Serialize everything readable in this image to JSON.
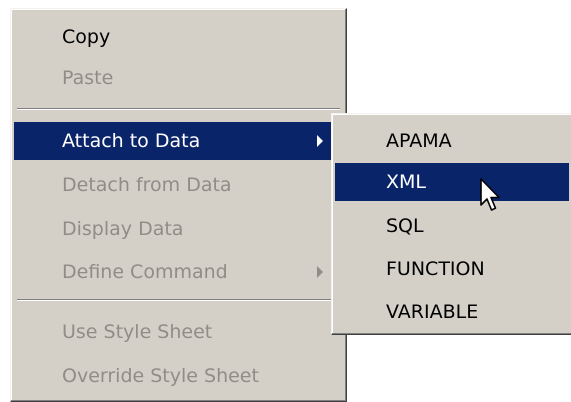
{
  "main_menu": {
    "copy": "Copy",
    "paste": "Paste",
    "attach_to_data": "Attach to Data",
    "detach_from_data": "Detach from Data",
    "display_data": "Display Data",
    "define_command": "Define Command",
    "use_style_sheet": "Use Style Sheet",
    "override_style_sheet": "Override Style Sheet"
  },
  "sub_menu": {
    "apama": "APAMA",
    "xml": "XML",
    "sql": "SQL",
    "function": "FUNCTION",
    "variable": "VARIABLE"
  },
  "state": {
    "highlighted_main": "Attach to Data",
    "highlighted_sub": "XML",
    "disabled": [
      "Paste",
      "Detach from Data",
      "Display Data",
      "Define Command",
      "Use Style Sheet",
      "Override Style Sheet"
    ]
  },
  "colors": {
    "menu_background": "#d4d0c8",
    "highlight": "#0a246a",
    "disabled_text": "#8f8d88"
  },
  "icons": {
    "submenu_arrow": "submenu-arrow-icon",
    "cursor": "mouse-pointer-icon"
  }
}
